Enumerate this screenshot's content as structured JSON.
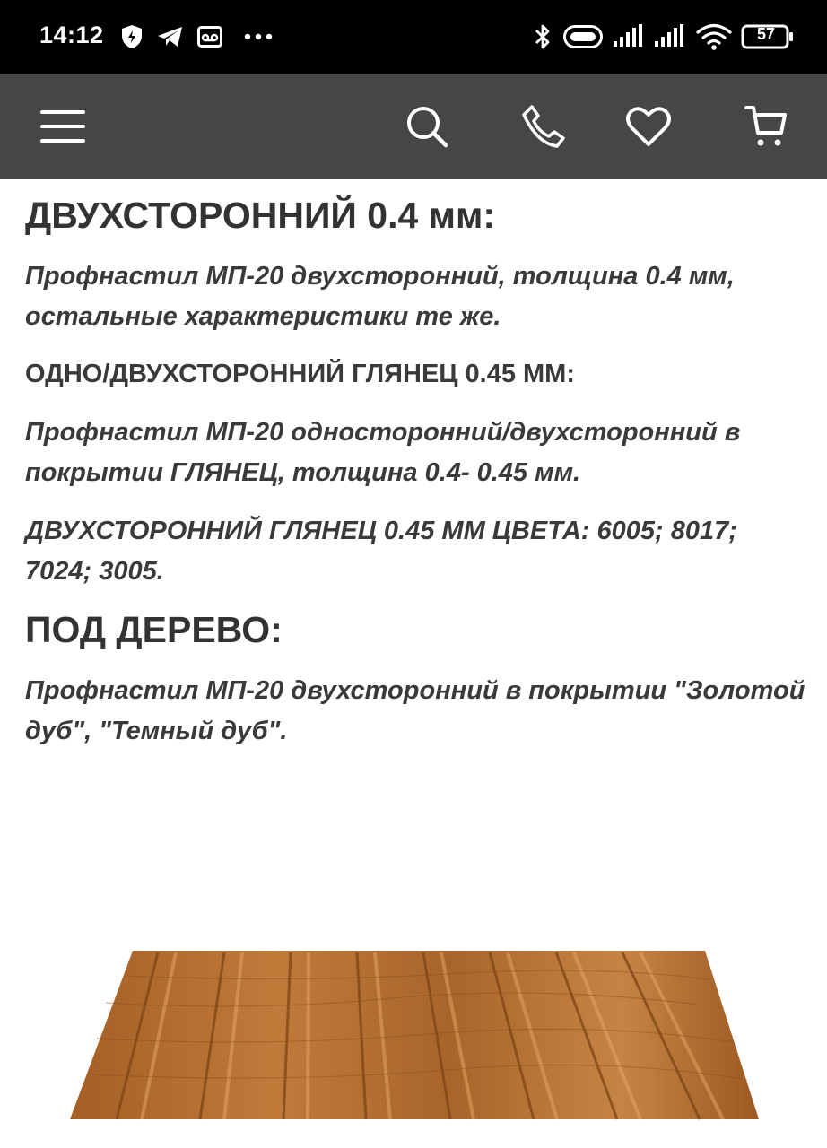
{
  "status_bar": {
    "time": "14:12",
    "battery": "57",
    "icons": [
      "vpn-shield-icon",
      "telegram-icon",
      "voicemail-icon",
      "more-dots-icon",
      "bluetooth-icon",
      "hotspot-icon",
      "signal-icon",
      "signal-icon",
      "wifi-icon",
      "battery-icon"
    ]
  },
  "toolbar": {
    "icons": [
      "menu-icon",
      "search-icon",
      "phone-icon",
      "heart-icon",
      "cart-icon"
    ],
    "background": "#464646"
  },
  "content": {
    "heading1": "ДВУХСТОРОННИЙ 0.4 мм:",
    "para1": [
      "Профнастил МП-20 двухсторонний, толщина 0.4 мм,",
      "остальные характеристики те же."
    ],
    "subheading1": "ОДНО/ДВУХСТОРОННИЙ ГЛЯНЕЦ 0.45 ММ:",
    "para2": [
      "Профнастил МП-20 односторонний/двухсторонний в",
      "покрытии ГЛЯНЕЦ, толщина 0.4- 0.45 мм."
    ],
    "para3": [
      "ДВУХСТОРОННИЙ ГЛЯНЕЦ 0.45 ММ ЦВЕТА: 6005; 8017;",
      "7024; 3005."
    ],
    "heading2": "ПОД ДЕРЕВО:",
    "para4": [
      "Профнастил МП-20 двухсторонний в покрытии \"Золотой",
      "дуб\", \"Темный дуб\"."
    ]
  },
  "product_image": {
    "subject": "corrugated-sheet-wood-texture",
    "color": "#b06a2c"
  }
}
